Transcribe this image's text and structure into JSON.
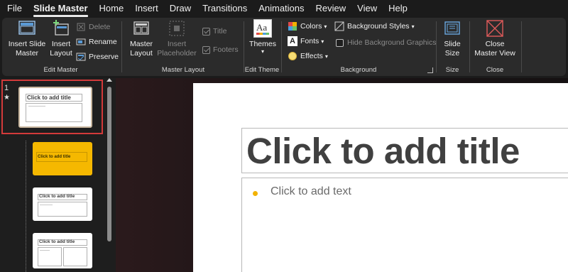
{
  "menu": {
    "tabs": [
      "File",
      "Slide Master",
      "Home",
      "Insert",
      "Draw",
      "Transitions",
      "Animations",
      "Review",
      "View",
      "Help"
    ],
    "active": "Slide Master"
  },
  "ribbon": {
    "edit_master": {
      "label": "Edit Master",
      "insert_slide_master": "Insert Slide Master",
      "insert_layout": "Insert Layout",
      "delete": "Delete",
      "rename": "Rename",
      "preserve": "Preserve"
    },
    "master_layout": {
      "label": "Master Layout",
      "master_layout": "Master Layout",
      "insert_placeholder": "Insert Placeholder",
      "title": "Title",
      "footers": "Footers"
    },
    "edit_theme": {
      "label": "Edit Theme",
      "themes": "Themes",
      "themes_icon_text": "Aa"
    },
    "background": {
      "label": "Background",
      "colors": "Colors",
      "fonts": "Fonts",
      "fonts_icon_text": "A",
      "effects": "Effects",
      "background_styles": "Background Styles",
      "hide_background_graphics": "Hide Background Graphics"
    },
    "size": {
      "label": "Size",
      "slide_size": "Slide Size"
    },
    "close": {
      "label": "Close",
      "close_master_view": "Close Master View"
    }
  },
  "thumbnails": {
    "slide_number": "1",
    "star": "★",
    "items": [
      {
        "title": "Click to add title",
        "style": "master"
      },
      {
        "title": "Click to add title",
        "style": "title-layout"
      },
      {
        "title": "Click to add title",
        "style": "content-layout"
      },
      {
        "title": "Click to add title",
        "style": "two-content-layout"
      }
    ]
  },
  "slide": {
    "title_placeholder": "Click to add title",
    "body_placeholder": "Click to add text"
  },
  "colors": {
    "accent_selection": "#d33a3a",
    "layout_fill": "#f5b800",
    "bullet": "#f2b200",
    "close_icon": "#e05a5a",
    "slide_size_icon": "#6aa8e0"
  }
}
